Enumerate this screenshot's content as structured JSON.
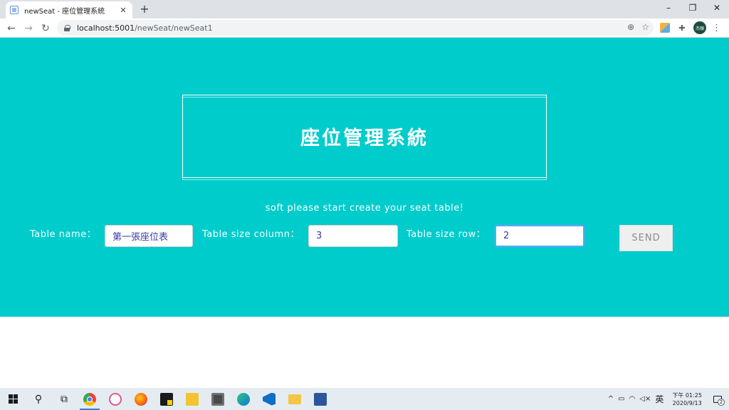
{
  "browser": {
    "tab_title": "newSeat - 座位管理系統",
    "tab_close": "✕",
    "new_tab": "+",
    "url_host": "localhost:5001",
    "url_path": "/newSeat/newSeat1",
    "profile_initials": "杰碩",
    "window_minimize": "–",
    "window_restore": "❐",
    "window_close": "✕",
    "back": "←",
    "forward": "→",
    "reload": "↻",
    "zoom_icon": "⊕",
    "star_icon": "☆",
    "extensions_icon": "✚",
    "menu_icon": "⋮"
  },
  "page": {
    "title": "座位管理系統",
    "subtitle": "soft please start create your seat table!",
    "form": {
      "table_name_label": "Table name：",
      "table_name_value": "第一張座位表",
      "column_label": "Table size column：",
      "column_value": "3",
      "row_label": "Table size row：",
      "row_value": "2",
      "send_label": "SEND"
    },
    "colors": {
      "hero": "#00cccc",
      "text": "#ffffff"
    }
  },
  "taskbar": {
    "search_icon": "⚲",
    "taskview_icon": "⧉",
    "tray_chevron": "^",
    "ime": "英",
    "time": "下午 01:25",
    "date": "2020/9/13",
    "notification_count": "2",
    "apps": [
      "chrome-icon",
      "paint-icon",
      "firefox-icon",
      "sticky-notes-icon",
      "tools-icon",
      "calculator-icon",
      "edge-icon",
      "vscode-icon",
      "file-explorer-icon",
      "word-icon"
    ]
  }
}
